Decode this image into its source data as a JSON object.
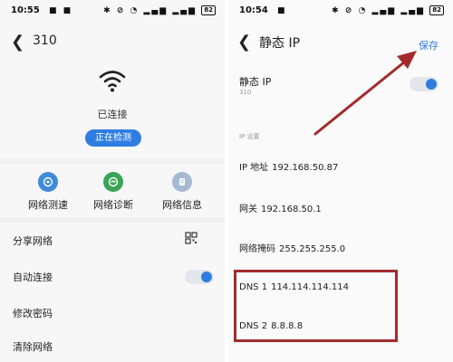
{
  "left": {
    "status": {
      "time": "10:55",
      "battery": "82"
    },
    "header": {
      "title": "310"
    },
    "connection_status": "已连接",
    "check_button": "正在检测",
    "tools": [
      {
        "label": "网络测速",
        "icon": "speed-icon",
        "color": "#3d8bd9"
      },
      {
        "label": "网络诊断",
        "icon": "diagnose-icon",
        "color": "#3aa457"
      },
      {
        "label": "网络信息",
        "icon": "info-icon",
        "color": "#a6b8d2"
      }
    ],
    "menu": {
      "share": "分享网络",
      "auto_connect": "自动连接",
      "change_password": "修改密码",
      "forget": "清除网络"
    },
    "auto_connect_on": true
  },
  "right": {
    "status": {
      "time": "10:54",
      "battery": "82"
    },
    "header": {
      "title": "静态 IP",
      "save": "保存"
    },
    "static_ip": {
      "label": "静态 IP",
      "sub": "310",
      "on": true
    },
    "section_label": "IP 设置",
    "fields": {
      "ip": {
        "label": "IP 地址",
        "value": "192.168.50.87"
      },
      "gateway": {
        "label": "网关",
        "value": "192.168.50.1"
      },
      "mask": {
        "label": "网络掩码",
        "value": "255.255.255.0"
      },
      "dns1": {
        "label": "DNS 1",
        "value": "114.114.114.114"
      },
      "dns2": {
        "label": "DNS 2",
        "value": "8.8.8.8"
      }
    }
  },
  "colors": {
    "accent": "#2f7de1",
    "annotation": "#a32b2d"
  }
}
